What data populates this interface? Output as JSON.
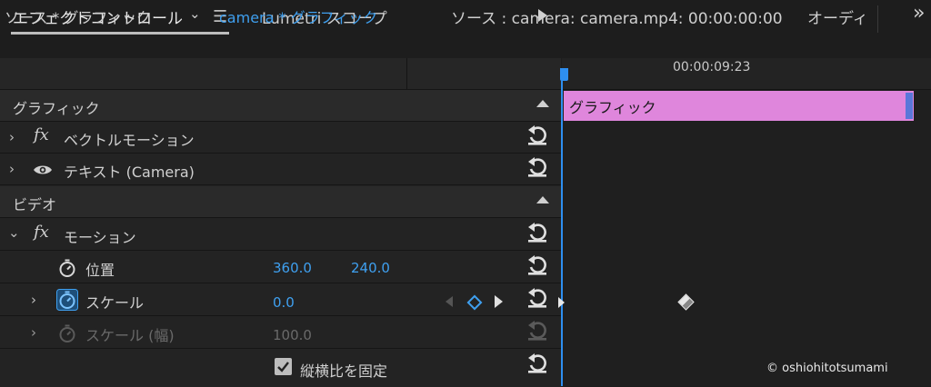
{
  "tabs": {
    "effect_controls": "エフェクトコントロール",
    "menu_glyph": "☰",
    "lumetri": "Lumetri スコープ",
    "source": "ソース : camera: camera.mp4: 00:00:00:00",
    "audio": "オーディ",
    "overflow": "»"
  },
  "source_row": {
    "left_label": "ソース * グラフィック",
    "right_label": "camera * グラフィック"
  },
  "sections": {
    "graphic": "グラフィック",
    "video": "ビデオ"
  },
  "effects": {
    "vector_motion": "ベクトルモーション",
    "text_layer": "テキスト (Camera)",
    "motion": "モーション"
  },
  "properties": {
    "position": {
      "label": "位置",
      "x": "360.0",
      "y": "240.0"
    },
    "scale": {
      "label": "スケール",
      "value": "0.0"
    },
    "scale_width": {
      "label": "スケール (幅)",
      "value": "100.0"
    },
    "uniform_scale": {
      "label": "縦横比を固定",
      "checked": true
    }
  },
  "timeline": {
    "ruler_time": "00:00:09:23",
    "clip_label": "グラフィック"
  },
  "watermark": "© oshiohitotsumami",
  "colors": {
    "accent_blue": "#3fa0f0",
    "clip_pink": "#df86dc",
    "playhead": "#2e8ff0"
  },
  "icons": {
    "reset": "reset-icon",
    "eye": "eye-icon",
    "stopwatch": "stopwatch-icon",
    "checkbox": "checkbox-icon",
    "keyframe": "keyframe-diamond-icon"
  }
}
